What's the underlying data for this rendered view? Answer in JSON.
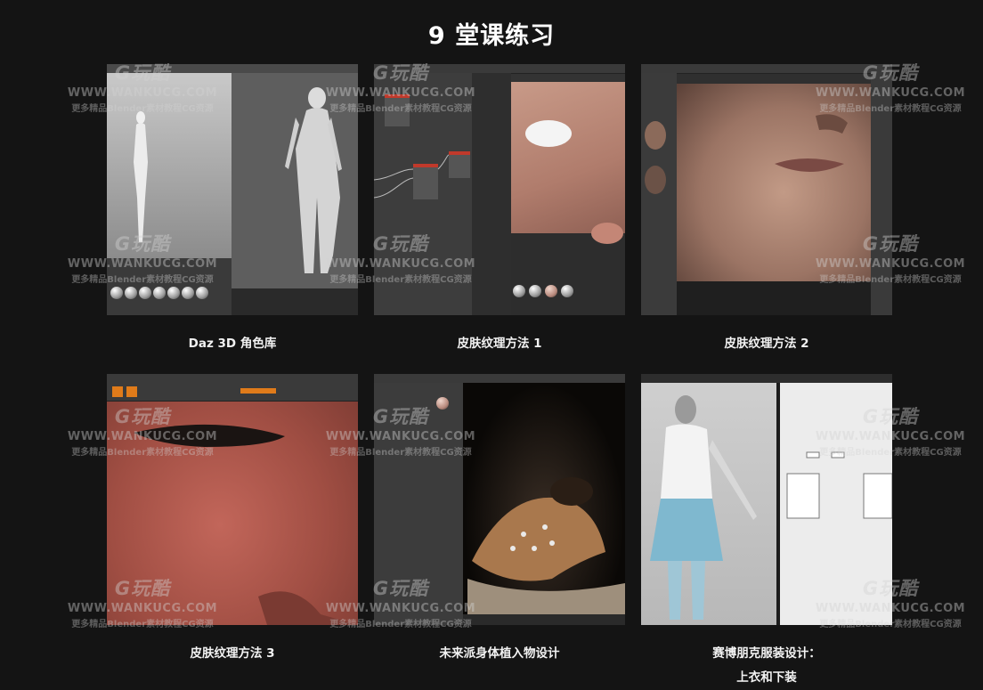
{
  "page": {
    "title": "9 堂课练习"
  },
  "cards": [
    {
      "caption": "Daz 3D 角色库"
    },
    {
      "caption": "皮肤纹理方法 1"
    },
    {
      "caption": "皮肤纹理方法 2"
    },
    {
      "caption": "皮肤纹理方法 3"
    },
    {
      "caption": "未来派身体植入物设计"
    },
    {
      "caption": "赛博朋克服装设计：",
      "caption_line2": "上衣和下装"
    }
  ],
  "watermark": {
    "logo": "G玩酷",
    "url": "WWW.WANKUCG.COM",
    "tagline": "更多精品Blender素材教程CG资源"
  },
  "colors": {
    "background": "#141414",
    "text": "#ffffff"
  }
}
